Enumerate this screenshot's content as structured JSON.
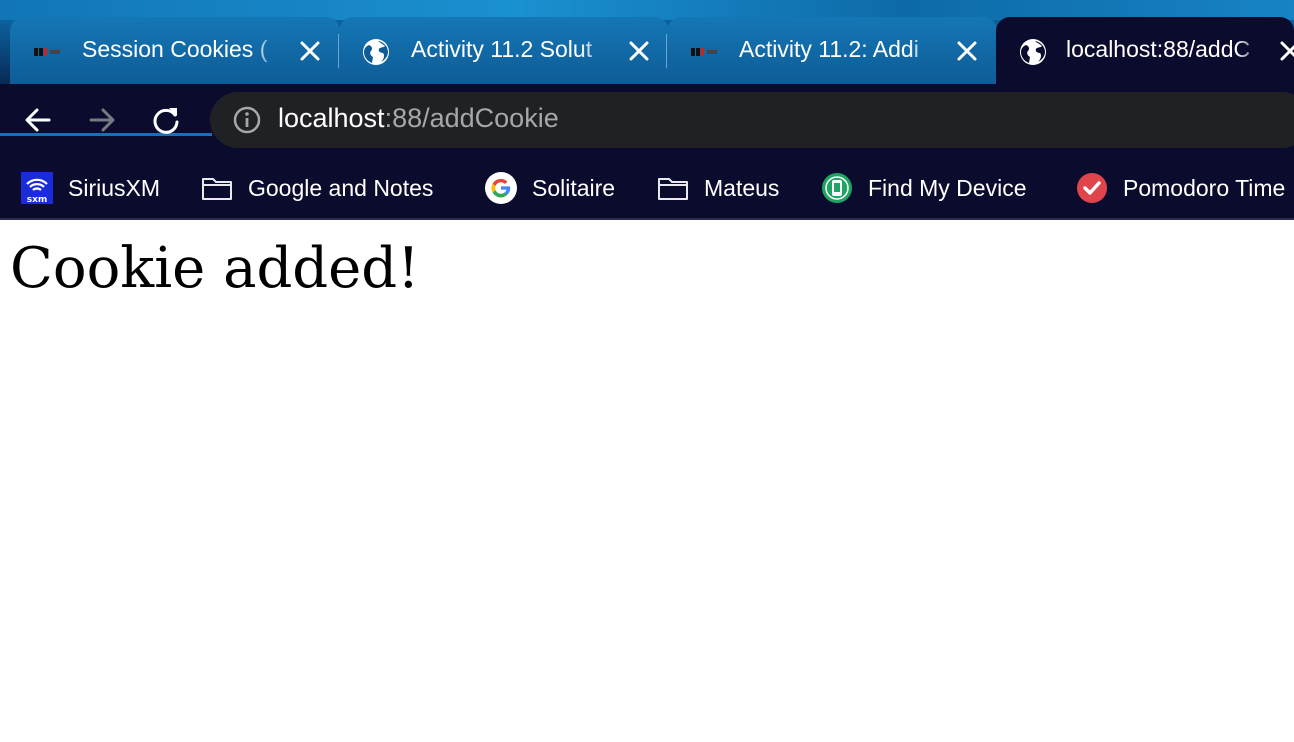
{
  "browser": {
    "tabs": [
      {
        "title": "Session Cookies (",
        "icon": "site-favicon-icon",
        "active": false
      },
      {
        "title": "Activity 11.2 Solut",
        "icon": "globe-icon",
        "active": false
      },
      {
        "title": "Activity 11.2: Addi",
        "icon": "site-favicon-icon",
        "active": false
      },
      {
        "title": "localhost:88/addC",
        "icon": "globe-icon",
        "active": true
      }
    ],
    "address_bar": {
      "host": "localhost",
      "path": ":88/addCookie"
    },
    "bookmarks": [
      {
        "label": "SiriusXM",
        "icon": "siriusxm-icon"
      },
      {
        "label": "Google and Notes",
        "icon": "folder-icon"
      },
      {
        "label": "Solitaire",
        "icon": "google-icon"
      },
      {
        "label": "Mateus",
        "icon": "folder-icon"
      },
      {
        "label": "Find My Device",
        "icon": "find-my-device-icon"
      },
      {
        "label": "Pomodoro Time",
        "icon": "checkmark-icon"
      }
    ],
    "colors": {
      "tab_strip": "#0b5d9a",
      "toolbar": "#0b0b2e",
      "omnibox": "#202124",
      "path_text": "#a5a7ab"
    }
  },
  "page": {
    "heading": "Cookie added!"
  }
}
